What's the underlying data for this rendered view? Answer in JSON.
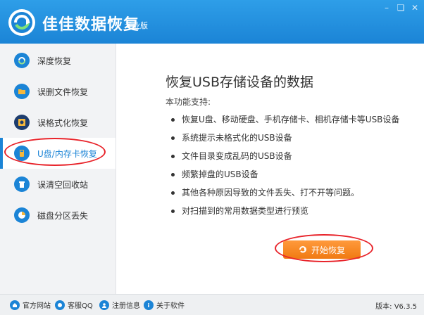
{
  "app": {
    "title": "佳佳数据恢复",
    "edition": "专业版",
    "accent_color": "#1b84d6",
    "button_color": "#f58a20",
    "window_controls": [
      "minimize-icon",
      "restore-icon",
      "close-icon"
    ]
  },
  "sidebar": {
    "items": [
      {
        "label": "深度恢复",
        "icon": "refresh-icon"
      },
      {
        "label": "误删文件恢复",
        "icon": "folder-icon"
      },
      {
        "label": "误格式化恢复",
        "icon": "disk-icon"
      },
      {
        "label": "U盘/内存卡恢复",
        "icon": "usb-icon",
        "active": true
      },
      {
        "label": "误清空回收站",
        "icon": "trash-icon"
      },
      {
        "label": "磁盘分区丢失",
        "icon": "pie-icon"
      }
    ]
  },
  "main": {
    "title": "恢复USB存储设备的数据",
    "intro": "本功能支持:",
    "features": [
      "恢复U盘、移动硬盘、手机存储卡、相机存储卡等USB设备",
      "系统提示未格式化的USB设备",
      "文件目录变成乱码的USB设备",
      "频繁掉盘的USB设备",
      "其他各种原因导致的文件丢失、打不开等问题。",
      "对扫描到的常用数据类型进行预览"
    ],
    "start_button": "开始恢复"
  },
  "footer": {
    "links": [
      {
        "label": "官方网站",
        "icon": "home-icon"
      },
      {
        "label": "客服QQ",
        "icon": "qq-icon"
      },
      {
        "label": "注册信息",
        "icon": "user-icon"
      },
      {
        "label": "关于软件",
        "icon": "info-icon"
      }
    ],
    "version": "版本: V6.3.5"
  }
}
